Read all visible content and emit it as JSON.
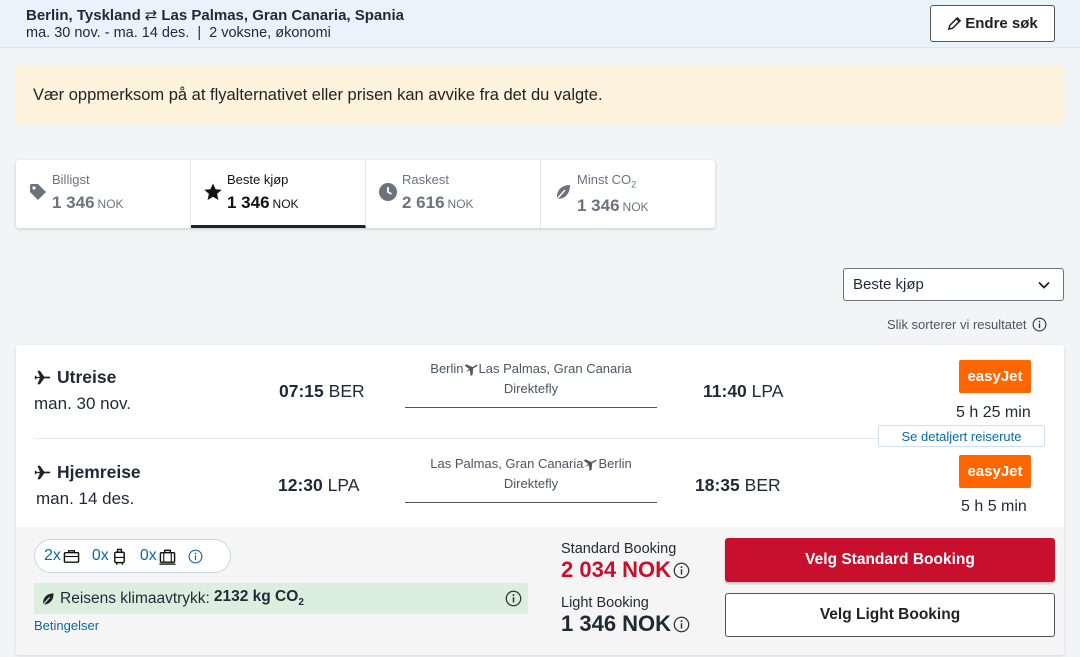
{
  "header": {
    "origin": "Berlin, Tyskland",
    "destination": "Las Palmas, Gran Canaria, Spania",
    "dates": "ma. 30 nov. - ma. 14 des.",
    "travellers": "2 voksne, økonomi",
    "edit_label": "Endre søk"
  },
  "warning": "Vær oppmerksom på at flyalternativet eller prisen kan avvike fra det du valgte.",
  "sort_tabs": [
    {
      "label": "Billigst",
      "price": "1 346",
      "currency": "NOK",
      "icon": "tag-icon",
      "active": false
    },
    {
      "label": "Beste kjøp",
      "price": "1 346",
      "currency": "NOK",
      "icon": "star-icon",
      "active": true
    },
    {
      "label": "Raskest",
      "price": "2 616",
      "currency": "NOK",
      "icon": "clock-icon",
      "active": false
    },
    {
      "label": "Minst CO",
      "label_sub": "2",
      "price": "1 346",
      "currency": "NOK",
      "icon": "leaf-icon",
      "active": false
    }
  ],
  "sort": {
    "selected": "Beste kjøp",
    "info_label": "Slik sorterer vi resultatet"
  },
  "result": {
    "outbound": {
      "title": "Utreise",
      "date": "man. 30 nov.",
      "dep_time": "07:15",
      "dep_airport": "BER",
      "from_city": "Berlin",
      "to_city": "Las Palmas, Gran Canaria",
      "stops": "Direktefly",
      "arr_time": "11:40",
      "arr_airport": "LPA",
      "airline": "easyJet",
      "duration": "5 h 25 min"
    },
    "details_link": "Se detaljert reiserute",
    "return": {
      "title": "Hjemreise",
      "date": "man. 14 des.",
      "dep_time": "12:30",
      "dep_airport": "LPA",
      "from_city": "Las Palmas, Gran Canaria",
      "to_city": "Berlin",
      "stops": "Direktefly",
      "arr_time": "18:35",
      "arr_airport": "BER",
      "airline": "easyJet",
      "duration": "5 h 5 min"
    },
    "baggage": {
      "personal": "2x",
      "cabin": "0x",
      "checked": "0x"
    },
    "co2": {
      "label": "Reisens klimaavtrykk:",
      "value": "2132 kg CO",
      "sub": "2"
    },
    "conditions_label": "Betingelser",
    "standard": {
      "label": "Standard Booking",
      "price": "2 034 NOK",
      "button": "Velg Standard Booking"
    },
    "light": {
      "label": "Light Booking",
      "price": "1 346 NOK",
      "button": "Velg Light Booking"
    }
  },
  "colors": {
    "accent_red": "#c8102e",
    "airline_orange": "#ff6600",
    "link_blue": "#0b6aa2",
    "warning_bg": "#fdf3dc",
    "co2_bg": "#dcefdf"
  }
}
